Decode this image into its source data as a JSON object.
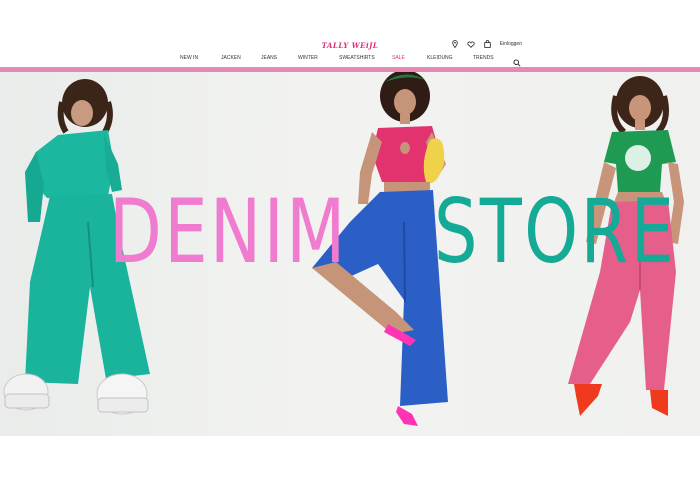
{
  "brand": {
    "logo_text": "TALLY WEiJL",
    "logo_color": "#d8317a"
  },
  "header": {
    "login_label": "Einloggen",
    "icons": [
      "location-pin-icon",
      "heart-icon",
      "bag-icon",
      "search-icon"
    ]
  },
  "nav": {
    "items": [
      {
        "label": "NEW IN"
      },
      {
        "label": "JACKEN"
      },
      {
        "label": "JEANS"
      },
      {
        "label": "WINTER"
      },
      {
        "label": "SWEATSHIRTS"
      },
      {
        "label": "SALE",
        "highlight": true
      },
      {
        "label": "KLEIDUNG"
      },
      {
        "label": "TRENDS"
      }
    ]
  },
  "hero": {
    "word_left": "DENIM",
    "word_right": "STORE",
    "colors": {
      "pink": "#f07ccf",
      "teal": "#15aa96",
      "divider": "#e58ab4",
      "sale": "#d8317a"
    }
  }
}
